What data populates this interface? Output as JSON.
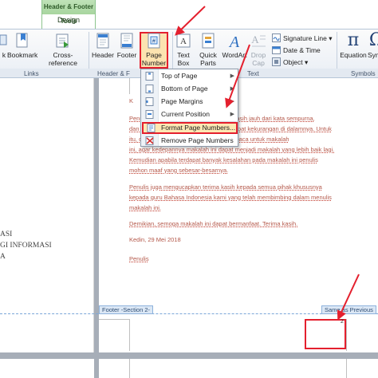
{
  "context_tab": {
    "title": "Header & Footer Tools",
    "tab_label": "Design"
  },
  "ribbon": {
    "links_buttons": [
      {
        "label": "k",
        "icon": "hyperlink-icon"
      },
      {
        "label": "Bookmark",
        "icon": "bookmark-icon"
      },
      {
        "label": "Cross-reference",
        "icon": "cross-reference-icon"
      }
    ],
    "header_footer_buttons": [
      {
        "label": "Header",
        "icon": "header-icon"
      },
      {
        "label": "Footer",
        "icon": "footer-icon"
      },
      {
        "label_line1": "Page",
        "label_line2": "Number",
        "icon": "page-number-icon"
      }
    ],
    "text_buttons": [
      {
        "label_line1": "Text",
        "label_line2": "Box",
        "icon": "text-box-icon"
      },
      {
        "label_line1": "Quick",
        "label_line2": "Parts",
        "icon": "quick-parts-icon"
      },
      {
        "label": "WordArt",
        "icon": "wordart-icon"
      },
      {
        "label_line1": "Drop",
        "label_line2": "Cap",
        "icon": "drop-cap-icon"
      }
    ],
    "small_buttons": [
      {
        "label": "Signature Line",
        "icon": "signature-line-icon"
      },
      {
        "label": "Date & Time",
        "icon": "date-time-icon"
      },
      {
        "label": "Object",
        "icon": "object-icon"
      }
    ],
    "symbols_buttons": [
      {
        "label": "Equation",
        "icon": "equation-icon",
        "glyph": "π"
      },
      {
        "label": "Sym",
        "icon": "symbol-icon",
        "glyph": "Ω"
      }
    ],
    "groups": {
      "links": "Links",
      "header_footer": "Header & F",
      "text": "Text",
      "symbols": "Symbols"
    }
  },
  "menu": {
    "items": [
      {
        "label": "Top of Page",
        "icon": "top-of-page-icon",
        "submenu": true
      },
      {
        "label": "Bottom of Page",
        "icon": "bottom-of-page-icon",
        "submenu": true
      },
      {
        "label": "Page Margins",
        "icon": "page-margins-icon",
        "submenu": true
      },
      {
        "label": "Current Position",
        "icon": "current-position-icon",
        "submenu": true
      },
      {
        "label": "Format Page Numbers...",
        "icon": "format-page-numbers-icon",
        "submenu": false
      },
      {
        "label": "Remove Page Numbers",
        "icon": "remove-page-numbers-icon",
        "submenu": false
      }
    ]
  },
  "document": {
    "left_page_lines": [
      "ASI",
      "GI INFORMASI",
      "A"
    ],
    "paragraphs": [
      "K",
      "Penulis menyadari bahwa makalah ini masih jauh dari kata sempurna,",
      "dan masih banyak kekurangan dan terdapat kekurangan di dalamnya. Untuk",
      "itu, diharapkan kritik dan saran dari pembaca untuk makalah",
      "ini, agar kedepannya makalah ini dapat menjadi makalah yang lebih baik lagi.",
      "Kemudian apabila terdapat banyak kesalahan pada makalah ini penulis",
      "mohon maaf yang sebesar-besarnya.",
      "Penulis juga mengucapkan terima kasih kepada semua pihak khususnya",
      "kepada guru Bahasa Indonesia kami yang telah membimbing dalam menulis",
      "makalah ini.",
      "Demikian, semoga makalah ini dapat bermanfaat. Terima kasih.",
      "Kedin, 29 Mei 2018",
      "Penulis"
    ],
    "footer_label": "Footer -Section 2-",
    "same_as_previous": "Same as Previous",
    "page_number": "2"
  },
  "colors": {
    "highlight_red": "#e4202e",
    "menu_hover": "#fde7b3",
    "text_red": "#b4584a",
    "tab_green": "#a7d59e"
  }
}
